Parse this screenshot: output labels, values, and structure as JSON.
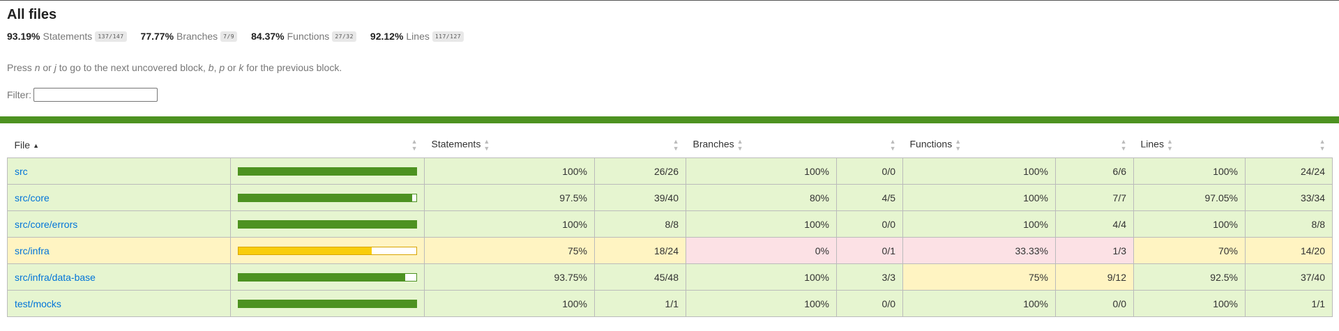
{
  "title": "All files",
  "summary": [
    {
      "pct": "93.19%",
      "label": "Statements",
      "fraction": "137/147"
    },
    {
      "pct": "77.77%",
      "label": "Branches",
      "fraction": "7/9"
    },
    {
      "pct": "84.37%",
      "label": "Functions",
      "fraction": "27/32"
    },
    {
      "pct": "92.12%",
      "label": "Lines",
      "fraction": "117/127"
    }
  ],
  "hint": {
    "p1": "Press ",
    "k1": "n",
    "p2": " or ",
    "k2": "j",
    "p3": " to go to the next uncovered block, ",
    "k3": "b",
    "p4": ", ",
    "k4": "p",
    "p5": " or ",
    "k5": "k",
    "p6": " for the previous block."
  },
  "filter": {
    "label": "Filter:",
    "value": ""
  },
  "colors": {
    "high": "#e6f5d0",
    "medium": "#fff4c2",
    "low": "#fce1e5",
    "bar_high": "#4d9221",
    "bar_medium": "#f9cd0b",
    "link": "#0074D9"
  },
  "columns": {
    "file": "File",
    "statements": "Statements",
    "branches": "Branches",
    "functions": "Functions",
    "lines": "Lines"
  },
  "rows": [
    {
      "file": "src",
      "cov": 100,
      "status": "high",
      "stmts_pct": "100%",
      "stmts": "26/26",
      "stmts_c": "high",
      "br_pct": "100%",
      "br": "0/0",
      "br_c": "high",
      "fn_pct": "100%",
      "fn": "6/6",
      "fn_c": "high",
      "ln_pct": "100%",
      "ln": "24/24",
      "ln_c": "high"
    },
    {
      "file": "src/core",
      "cov": 97.5,
      "status": "high",
      "stmts_pct": "97.5%",
      "stmts": "39/40",
      "stmts_c": "high",
      "br_pct": "80%",
      "br": "4/5",
      "br_c": "high",
      "fn_pct": "100%",
      "fn": "7/7",
      "fn_c": "high",
      "ln_pct": "97.05%",
      "ln": "33/34",
      "ln_c": "high"
    },
    {
      "file": "src/core/errors",
      "cov": 100,
      "status": "high",
      "stmts_pct": "100%",
      "stmts": "8/8",
      "stmts_c": "high",
      "br_pct": "100%",
      "br": "0/0",
      "br_c": "high",
      "fn_pct": "100%",
      "fn": "4/4",
      "fn_c": "high",
      "ln_pct": "100%",
      "ln": "8/8",
      "ln_c": "high"
    },
    {
      "file": "src/infra",
      "cov": 75,
      "status": "medium",
      "stmts_pct": "75%",
      "stmts": "18/24",
      "stmts_c": "medium",
      "br_pct": "0%",
      "br": "0/1",
      "br_c": "low",
      "fn_pct": "33.33%",
      "fn": "1/3",
      "fn_c": "low",
      "ln_pct": "70%",
      "ln": "14/20",
      "ln_c": "medium"
    },
    {
      "file": "src/infra/data-base",
      "cov": 93.75,
      "status": "high",
      "stmts_pct": "93.75%",
      "stmts": "45/48",
      "stmts_c": "high",
      "br_pct": "100%",
      "br": "3/3",
      "br_c": "high",
      "fn_pct": "75%",
      "fn": "9/12",
      "fn_c": "medium",
      "ln_pct": "92.5%",
      "ln": "37/40",
      "ln_c": "high"
    },
    {
      "file": "test/mocks",
      "cov": 100,
      "status": "high",
      "stmts_pct": "100%",
      "stmts": "1/1",
      "stmts_c": "high",
      "br_pct": "100%",
      "br": "0/0",
      "br_c": "high",
      "fn_pct": "100%",
      "fn": "0/0",
      "fn_c": "high",
      "ln_pct": "100%",
      "ln": "1/1",
      "ln_c": "high"
    }
  ]
}
